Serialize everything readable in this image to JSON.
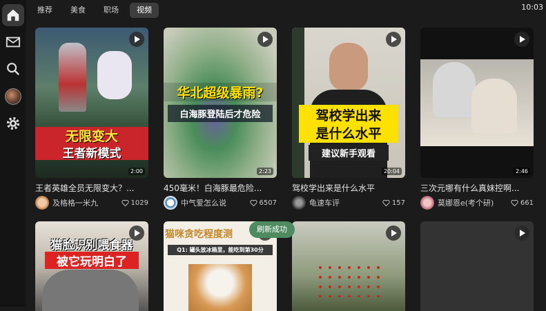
{
  "tabs": [
    "推荐",
    "美食",
    "职场",
    "视频"
  ],
  "active_tab": "视频",
  "clock": "10:03",
  "sidebar": [
    "home-icon",
    "mail-icon",
    "search-icon",
    "avatar",
    "gear-icon"
  ],
  "toast": "刷新成功",
  "cards": [
    {
      "title": "王者英雄全员无限变大？...",
      "duration": "2:00",
      "author": "及格格一米九",
      "likes": "1029",
      "overlay": [
        "无限变大",
        "王者新模式"
      ]
    },
    {
      "title": "450毫米！白海豚最危险...",
      "duration": "2:23",
      "author": "中气爱怎么说",
      "likes": "6507",
      "overlay": [
        "华北超级暴雨?",
        "白海豚登陆后才危险"
      ]
    },
    {
      "title": "驾校学出来是什么水平",
      "duration": "20:04",
      "author": "龟速车评",
      "likes": "157",
      "overlay": [
        "驾校学出来",
        "是什么水平",
        "建议新手观看"
      ]
    },
    {
      "title": "三次元哪有什么真妹控啊...",
      "duration": "2:46",
      "author": "莫娜恩e(考个研)",
      "likes": "661",
      "overlay": []
    },
    {
      "overlay": [
        "猫脸识别喂食器",
        "被它玩明白了"
      ]
    },
    {
      "overlay": [
        "猫咪贪吃程度测",
        "Q1: 罐头放冰箱里，能吃到第30分"
      ]
    },
    {
      "overlay": []
    },
    {
      "overlay": []
    }
  ]
}
